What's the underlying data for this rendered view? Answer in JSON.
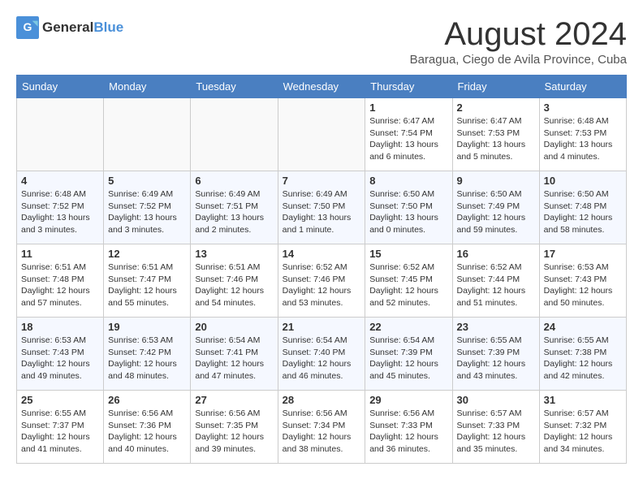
{
  "header": {
    "logo_general": "General",
    "logo_blue": "Blue",
    "month": "August 2024",
    "location": "Baragua, Ciego de Avila Province, Cuba"
  },
  "days_of_week": [
    "Sunday",
    "Monday",
    "Tuesday",
    "Wednesday",
    "Thursday",
    "Friday",
    "Saturday"
  ],
  "weeks": [
    [
      {
        "day": "",
        "info": ""
      },
      {
        "day": "",
        "info": ""
      },
      {
        "day": "",
        "info": ""
      },
      {
        "day": "",
        "info": ""
      },
      {
        "day": "1",
        "info": "Sunrise: 6:47 AM\nSunset: 7:54 PM\nDaylight: 13 hours and 6 minutes."
      },
      {
        "day": "2",
        "info": "Sunrise: 6:47 AM\nSunset: 7:53 PM\nDaylight: 13 hours and 5 minutes."
      },
      {
        "day": "3",
        "info": "Sunrise: 6:48 AM\nSunset: 7:53 PM\nDaylight: 13 hours and 4 minutes."
      }
    ],
    [
      {
        "day": "4",
        "info": "Sunrise: 6:48 AM\nSunset: 7:52 PM\nDaylight: 13 hours and 3 minutes."
      },
      {
        "day": "5",
        "info": "Sunrise: 6:49 AM\nSunset: 7:52 PM\nDaylight: 13 hours and 3 minutes."
      },
      {
        "day": "6",
        "info": "Sunrise: 6:49 AM\nSunset: 7:51 PM\nDaylight: 13 hours and 2 minutes."
      },
      {
        "day": "7",
        "info": "Sunrise: 6:49 AM\nSunset: 7:50 PM\nDaylight: 13 hours and 1 minute."
      },
      {
        "day": "8",
        "info": "Sunrise: 6:50 AM\nSunset: 7:50 PM\nDaylight: 13 hours and 0 minutes."
      },
      {
        "day": "9",
        "info": "Sunrise: 6:50 AM\nSunset: 7:49 PM\nDaylight: 12 hours and 59 minutes."
      },
      {
        "day": "10",
        "info": "Sunrise: 6:50 AM\nSunset: 7:48 PM\nDaylight: 12 hours and 58 minutes."
      }
    ],
    [
      {
        "day": "11",
        "info": "Sunrise: 6:51 AM\nSunset: 7:48 PM\nDaylight: 12 hours and 57 minutes."
      },
      {
        "day": "12",
        "info": "Sunrise: 6:51 AM\nSunset: 7:47 PM\nDaylight: 12 hours and 55 minutes."
      },
      {
        "day": "13",
        "info": "Sunrise: 6:51 AM\nSunset: 7:46 PM\nDaylight: 12 hours and 54 minutes."
      },
      {
        "day": "14",
        "info": "Sunrise: 6:52 AM\nSunset: 7:46 PM\nDaylight: 12 hours and 53 minutes."
      },
      {
        "day": "15",
        "info": "Sunrise: 6:52 AM\nSunset: 7:45 PM\nDaylight: 12 hours and 52 minutes."
      },
      {
        "day": "16",
        "info": "Sunrise: 6:52 AM\nSunset: 7:44 PM\nDaylight: 12 hours and 51 minutes."
      },
      {
        "day": "17",
        "info": "Sunrise: 6:53 AM\nSunset: 7:43 PM\nDaylight: 12 hours and 50 minutes."
      }
    ],
    [
      {
        "day": "18",
        "info": "Sunrise: 6:53 AM\nSunset: 7:43 PM\nDaylight: 12 hours and 49 minutes."
      },
      {
        "day": "19",
        "info": "Sunrise: 6:53 AM\nSunset: 7:42 PM\nDaylight: 12 hours and 48 minutes."
      },
      {
        "day": "20",
        "info": "Sunrise: 6:54 AM\nSunset: 7:41 PM\nDaylight: 12 hours and 47 minutes."
      },
      {
        "day": "21",
        "info": "Sunrise: 6:54 AM\nSunset: 7:40 PM\nDaylight: 12 hours and 46 minutes."
      },
      {
        "day": "22",
        "info": "Sunrise: 6:54 AM\nSunset: 7:39 PM\nDaylight: 12 hours and 45 minutes."
      },
      {
        "day": "23",
        "info": "Sunrise: 6:55 AM\nSunset: 7:39 PM\nDaylight: 12 hours and 43 minutes."
      },
      {
        "day": "24",
        "info": "Sunrise: 6:55 AM\nSunset: 7:38 PM\nDaylight: 12 hours and 42 minutes."
      }
    ],
    [
      {
        "day": "25",
        "info": "Sunrise: 6:55 AM\nSunset: 7:37 PM\nDaylight: 12 hours and 41 minutes."
      },
      {
        "day": "26",
        "info": "Sunrise: 6:56 AM\nSunset: 7:36 PM\nDaylight: 12 hours and 40 minutes."
      },
      {
        "day": "27",
        "info": "Sunrise: 6:56 AM\nSunset: 7:35 PM\nDaylight: 12 hours and 39 minutes."
      },
      {
        "day": "28",
        "info": "Sunrise: 6:56 AM\nSunset: 7:34 PM\nDaylight: 12 hours and 38 minutes."
      },
      {
        "day": "29",
        "info": "Sunrise: 6:56 AM\nSunset: 7:33 PM\nDaylight: 12 hours and 36 minutes."
      },
      {
        "day": "30",
        "info": "Sunrise: 6:57 AM\nSunset: 7:33 PM\nDaylight: 12 hours and 35 minutes."
      },
      {
        "day": "31",
        "info": "Sunrise: 6:57 AM\nSunset: 7:32 PM\nDaylight: 12 hours and 34 minutes."
      }
    ]
  ]
}
